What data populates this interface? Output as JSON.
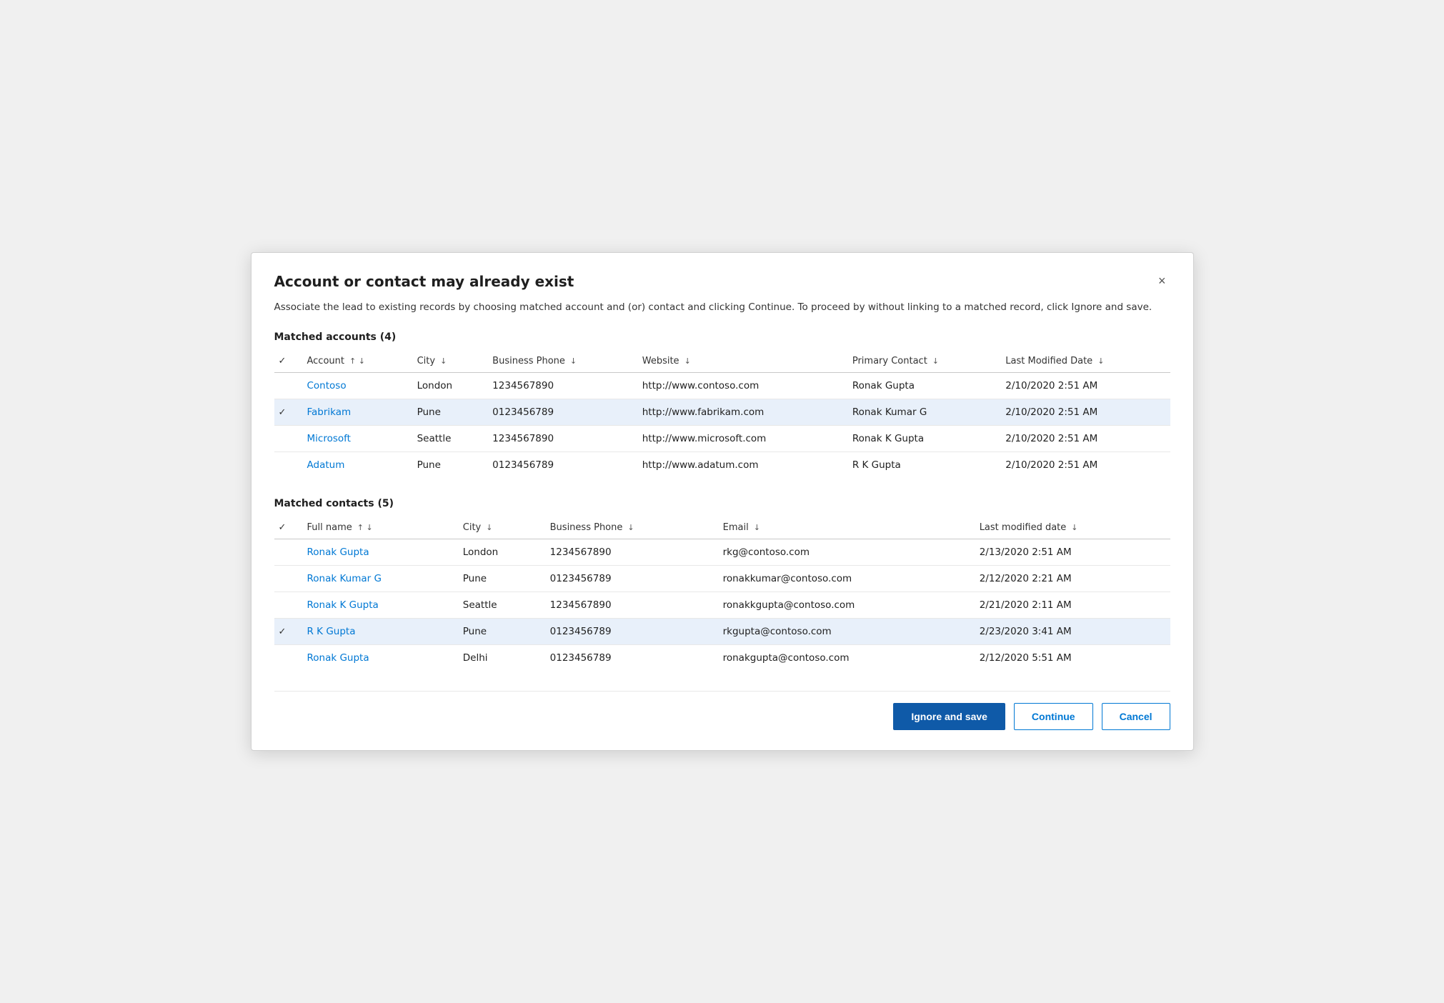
{
  "dialog": {
    "title": "Account or contact may already exist",
    "description": "Associate the lead to existing records by choosing matched account and (or) contact and clicking Continue. To proceed by without linking to a matched record, click Ignore and save.",
    "close_label": "×"
  },
  "accounts": {
    "section_title": "Matched accounts (4)",
    "columns": [
      {
        "id": "check",
        "label": ""
      },
      {
        "id": "account",
        "label": "Account",
        "sort": true
      },
      {
        "id": "city",
        "label": "City",
        "sort_down": true
      },
      {
        "id": "business_phone",
        "label": "Business Phone",
        "sort_down": true
      },
      {
        "id": "website",
        "label": "Website",
        "sort_down": true
      },
      {
        "id": "primary_contact",
        "label": "Primary Contact",
        "sort_down": true
      },
      {
        "id": "last_modified",
        "label": "Last Modified Date",
        "sort_down": true
      }
    ],
    "rows": [
      {
        "selected": false,
        "account": "Contoso",
        "city": "London",
        "business_phone": "1234567890",
        "website": "http://www.contoso.com",
        "primary_contact": "Ronak Gupta",
        "last_modified": "2/10/2020 2:51 AM"
      },
      {
        "selected": true,
        "account": "Fabrikam",
        "city": "Pune",
        "business_phone": "0123456789",
        "website": "http://www.fabrikam.com",
        "primary_contact": "Ronak Kumar G",
        "last_modified": "2/10/2020 2:51 AM"
      },
      {
        "selected": false,
        "account": "Microsoft",
        "city": "Seattle",
        "business_phone": "1234567890",
        "website": "http://www.microsoft.com",
        "primary_contact": "Ronak K Gupta",
        "last_modified": "2/10/2020 2:51 AM"
      },
      {
        "selected": false,
        "account": "Adatum",
        "city": "Pune",
        "business_phone": "0123456789",
        "website": "http://www.adatum.com",
        "primary_contact": "R K Gupta",
        "last_modified": "2/10/2020 2:51 AM"
      }
    ]
  },
  "contacts": {
    "section_title": "Matched contacts (5)",
    "columns": [
      {
        "id": "check",
        "label": ""
      },
      {
        "id": "fullname",
        "label": "Full name",
        "sort": true
      },
      {
        "id": "city",
        "label": "City",
        "sort_down": true
      },
      {
        "id": "business_phone",
        "label": "Business Phone",
        "sort_down": true
      },
      {
        "id": "email",
        "label": "Email",
        "sort_down": true
      },
      {
        "id": "last_modified",
        "label": "Last modified date",
        "sort_down": true
      }
    ],
    "rows": [
      {
        "selected": false,
        "fullname": "Ronak Gupta",
        "city": "London",
        "business_phone": "1234567890",
        "email": "rkg@contoso.com",
        "last_modified": "2/13/2020 2:51 AM"
      },
      {
        "selected": false,
        "fullname": "Ronak Kumar G",
        "city": "Pune",
        "business_phone": "0123456789",
        "email": "ronakkumar@contoso.com",
        "last_modified": "2/12/2020 2:21 AM"
      },
      {
        "selected": false,
        "fullname": "Ronak K Gupta",
        "city": "Seattle",
        "business_phone": "1234567890",
        "email": "ronakkgupta@contoso.com",
        "last_modified": "2/21/2020 2:11 AM"
      },
      {
        "selected": true,
        "fullname": "R K Gupta",
        "city": "Pune",
        "business_phone": "0123456789",
        "email": "rkgupta@contoso.com",
        "last_modified": "2/23/2020 3:41 AM"
      },
      {
        "selected": false,
        "fullname": "Ronak Gupta",
        "city": "Delhi",
        "business_phone": "0123456789",
        "email": "ronakgupta@contoso.com",
        "last_modified": "2/12/2020 5:51 AM"
      }
    ]
  },
  "footer": {
    "ignore_save_label": "Ignore and save",
    "continue_label": "Continue",
    "cancel_label": "Cancel"
  }
}
